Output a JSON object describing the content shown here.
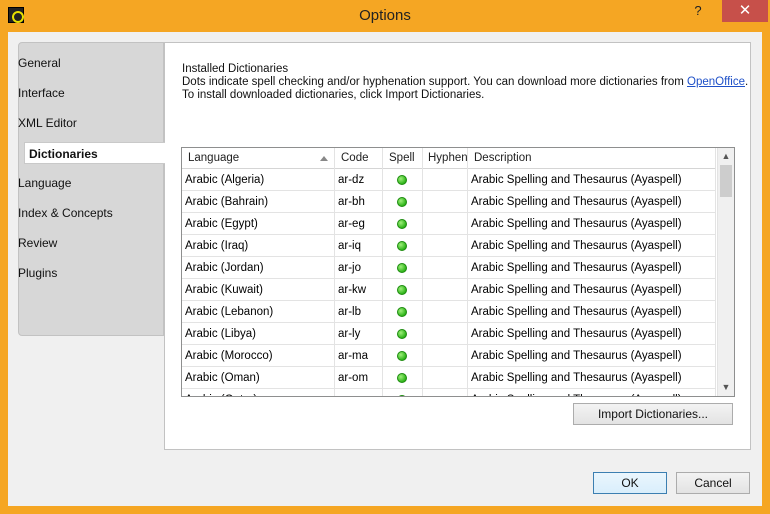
{
  "window": {
    "title": "Options",
    "help_label": "?",
    "close_label": "✕"
  },
  "nav": {
    "items": [
      {
        "label": "General"
      },
      {
        "label": "Interface"
      },
      {
        "label": "XML Editor"
      },
      {
        "label": "Dictionaries",
        "active": true
      },
      {
        "label": "Language"
      },
      {
        "label": "Index & Concepts"
      },
      {
        "label": "Review"
      },
      {
        "label": "Plugins"
      }
    ]
  },
  "content": {
    "heading": "Installed Dictionaries",
    "line1_text": "Dots indicate spell checking and/or hyphenation support. You can download more dictionaries from ",
    "line1_link": "OpenOffice",
    "line1_end": ".",
    "line2": "To install downloaded dictionaries, click Import Dictionaries."
  },
  "table": {
    "columns": [
      "Language",
      "Code",
      "Spell",
      "Hyphen",
      "Description"
    ],
    "rows": [
      {
        "language": "Arabic (Algeria)",
        "code": "ar-dz",
        "spell": true,
        "hyphen": false,
        "description": "Arabic Spelling and Thesaurus (Ayaspell)"
      },
      {
        "language": "Arabic (Bahrain)",
        "code": "ar-bh",
        "spell": true,
        "hyphen": false,
        "description": "Arabic Spelling and Thesaurus (Ayaspell)"
      },
      {
        "language": "Arabic (Egypt)",
        "code": "ar-eg",
        "spell": true,
        "hyphen": false,
        "description": "Arabic Spelling and Thesaurus (Ayaspell)"
      },
      {
        "language": "Arabic (Iraq)",
        "code": "ar-iq",
        "spell": true,
        "hyphen": false,
        "description": "Arabic Spelling and Thesaurus (Ayaspell)"
      },
      {
        "language": "Arabic (Jordan)",
        "code": "ar-jo",
        "spell": true,
        "hyphen": false,
        "description": "Arabic Spelling and Thesaurus (Ayaspell)"
      },
      {
        "language": "Arabic (Kuwait)",
        "code": "ar-kw",
        "spell": true,
        "hyphen": false,
        "description": "Arabic Spelling and Thesaurus (Ayaspell)"
      },
      {
        "language": "Arabic (Lebanon)",
        "code": "ar-lb",
        "spell": true,
        "hyphen": false,
        "description": "Arabic Spelling and Thesaurus (Ayaspell)"
      },
      {
        "language": "Arabic (Libya)",
        "code": "ar-ly",
        "spell": true,
        "hyphen": false,
        "description": "Arabic Spelling and Thesaurus (Ayaspell)"
      },
      {
        "language": "Arabic (Morocco)",
        "code": "ar-ma",
        "spell": true,
        "hyphen": false,
        "description": "Arabic Spelling and Thesaurus (Ayaspell)"
      },
      {
        "language": "Arabic (Oman)",
        "code": "ar-om",
        "spell": true,
        "hyphen": false,
        "description": "Arabic Spelling and Thesaurus (Ayaspell)"
      },
      {
        "language": "Arabic (Qatar)",
        "code": "ar-qa",
        "spell": true,
        "hyphen": false,
        "description": "Arabic Spelling and Thesaurus (Ayaspell)"
      }
    ]
  },
  "buttons": {
    "import": "Import Dictionaries...",
    "ok": "OK",
    "cancel": "Cancel"
  }
}
